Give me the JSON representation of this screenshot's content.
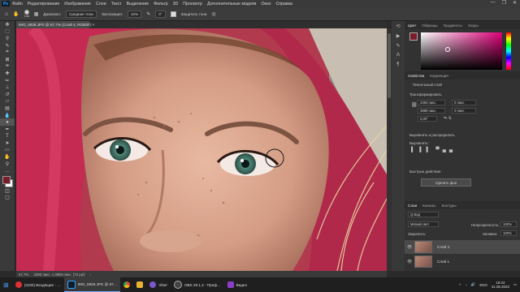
{
  "menubar": {
    "logo": "Ps",
    "items": [
      "Файл",
      "Редактирование",
      "Изображение",
      "Слои",
      "Текст",
      "Выделение",
      "Фильтр",
      "3D",
      "Просмотр",
      "Дополнительные модели",
      "Окно",
      "Справка"
    ],
    "window_controls": [
      "—",
      "❐",
      "✕"
    ]
  },
  "options": {
    "brush_size": "146",
    "mode_label": "Диапазон:",
    "mode_value": "Средние тона",
    "exposure_label": "Экспозиция:",
    "exposure_value": "10%",
    "angle_value": "0°",
    "protect_label": "Защитить тона"
  },
  "document": {
    "tab_title": "IMG_5928.JPG @ 67,7% (Слой 4, RGB/8*) ×",
    "zoom": "67,7%",
    "dimensions": "2393 пикс. x 3989 пикс. (72 ppi)"
  },
  "panels": {
    "color_tabs": [
      "Цвет",
      "Образцы",
      "Градиенты",
      "Узоры"
    ],
    "properties_tabs": [
      "Свойства",
      "Коррекция"
    ],
    "pixel_layer": "Пиксельный слой",
    "transform_title": "Трансформировать",
    "transform": {
      "w": "2393 пикс.",
      "h": "3989 пикс.",
      "x": "0 пикс.",
      "y": "0 пикс.",
      "angle": "0,00°"
    },
    "align_title": "Выровнять и распределить",
    "align_label": "Выровнять:",
    "quick_title": "Быстрые действия",
    "quick_button": "Удалить фон",
    "layers_tabs": [
      "Слои",
      "Каналы",
      "Контуры"
    ],
    "layer_filter": "Q Вид",
    "blend_mode": "Мягкий свет",
    "opacity_label": "Непрозрачность:",
    "opacity_value": "100%",
    "fill_label": "Заливка:",
    "fill_value": "100%",
    "lock_label": "Закрепить:",
    "layers": [
      {
        "name": "Слой 4"
      },
      {
        "name": "Слой 1"
      }
    ]
  },
  "taskbar": {
    "items": [
      {
        "label": "(3100) Входящие - …",
        "color": "#e03030"
      },
      {
        "label": "IMG_5928.JPG @ 67…",
        "color": "#31a8ff",
        "active": true
      },
      {
        "label": "",
        "color": "#3da84a"
      },
      {
        "label": "",
        "color": "#e8b533"
      },
      {
        "label": "Viber",
        "color": "#7b58c9"
      },
      {
        "label": "OBS 29.1.3 - Проф…",
        "color": "#444"
      },
      {
        "label": "Видео",
        "color": "#8a3ec9"
      }
    ],
    "lang": "ENG",
    "time": "19:24",
    "date": "21.06.2023"
  },
  "colors": {
    "foreground": "#7a1c2c",
    "background": "#ffffff",
    "accent": "#31a8ff"
  }
}
